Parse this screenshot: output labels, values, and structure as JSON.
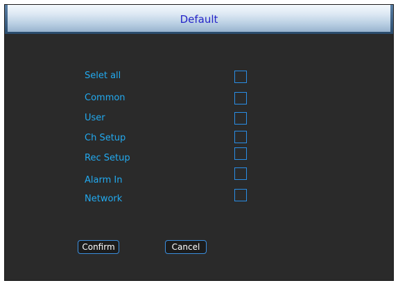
{
  "dialog": {
    "title": "Default"
  },
  "options": [
    {
      "label": "Selet all"
    },
    {
      "label": "Common"
    },
    {
      "label": "User"
    },
    {
      "label": "Ch Setup"
    },
    {
      "label": "Rec Setup"
    },
    {
      "label": "Alarm In"
    },
    {
      "label": "Network"
    }
  ],
  "buttons": {
    "confirm_label": "Confirm",
    "cancel_label": "Cancel"
  },
  "colors": {
    "label_text": "#22aaf0",
    "checkbox_border": "#2a8ee6",
    "title_text": "#2424c8",
    "panel_bg": "#2a2a2a"
  }
}
